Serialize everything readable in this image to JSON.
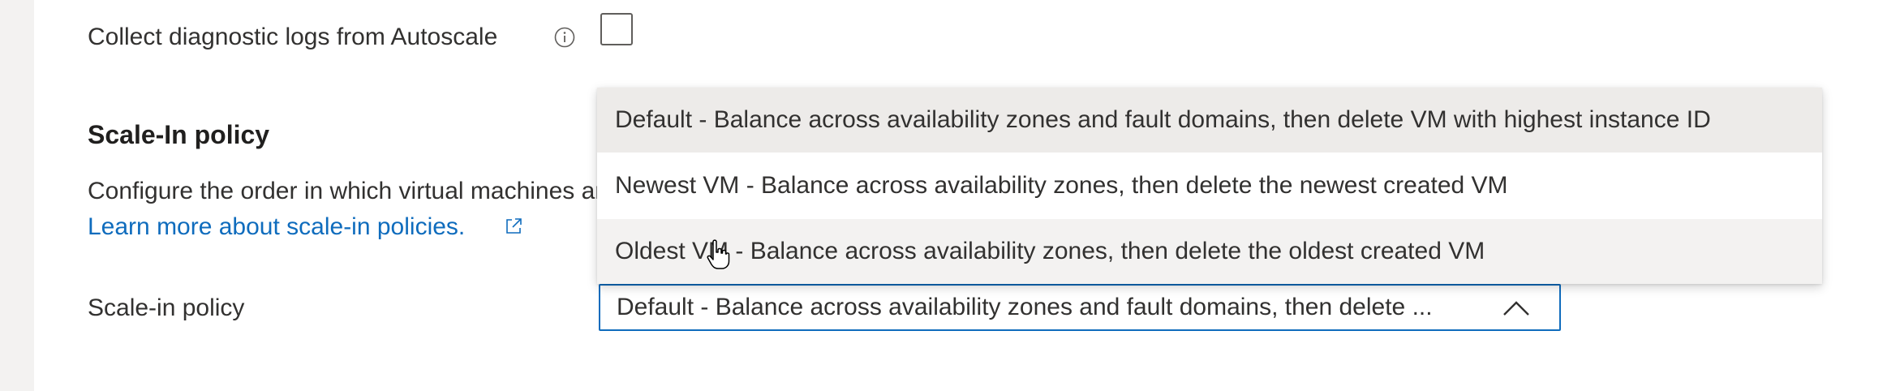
{
  "autoscale": {
    "diagnostic_label": "Collect diagnostic logs from Autoscale",
    "diagnostic_checked": false
  },
  "scale_in": {
    "section_title": "Scale-In policy",
    "description": "Configure the order in which virtual machines are selected for deletion during a scale-in operation.",
    "learn_more_link": "Learn more about scale-in policies.",
    "field_label": "Scale-in policy",
    "selected_value": "Default - Balance across availability zones and fault domains, then delete ...",
    "options": [
      {
        "label": "Default - Balance across availability zones and fault domains, then delete VM with highest instance ID"
      },
      {
        "label": "Newest VM - Balance across availability zones, then delete the newest created VM"
      },
      {
        "label": "Oldest VM - Balance across availability zones, then delete the oldest created VM"
      }
    ]
  },
  "colors": {
    "link": "#0f6cbd",
    "focus_border": "#0f6cbd",
    "text": "#323130"
  },
  "icons": {
    "info": "info-icon",
    "external": "external-link-icon",
    "chevron": "chevron-up-icon",
    "cursor": "hand-pointer-icon"
  }
}
